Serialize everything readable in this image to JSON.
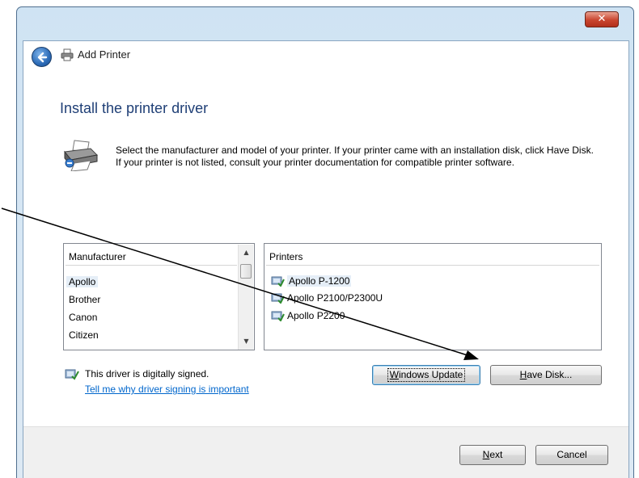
{
  "window": {
    "title": "Add Printer",
    "close_label": "✕"
  },
  "page": {
    "heading": "Install the printer driver",
    "description": "Select the manufacturer and model of your printer. If your printer came with an installation disk, click Have Disk. If your printer is not listed, consult your printer documentation for compatible printer software."
  },
  "manufacturer_list": {
    "header": "Manufacturer",
    "items": [
      "Apollo",
      "Brother",
      "Canon",
      "Citizen"
    ],
    "selected": "Apollo"
  },
  "printers_list": {
    "header": "Printers",
    "items": [
      "Apollo P-1200",
      "Apollo P2100/P2300U",
      "Apollo P2200"
    ],
    "selected": "Apollo P-1200"
  },
  "signing": {
    "status": "This driver is digitally signed.",
    "link": "Tell me why driver signing is important"
  },
  "buttons": {
    "windows_update": {
      "accel": "W",
      "rest": "indows Update"
    },
    "have_disk": {
      "accel": "H",
      "rest": "ave Disk..."
    },
    "next": {
      "accel": "N",
      "rest": "ext"
    },
    "cancel": "Cancel"
  },
  "icons": {
    "back": "back-arrow-icon",
    "printer_small": "printer-icon",
    "printer_large": "printer-setup-icon",
    "driver": "driver-icon",
    "close": "close-icon"
  },
  "colors": {
    "heading": "#1f3f76",
    "link": "#0066cc",
    "close_button": "#c9452f",
    "annotation_arrow": "#000000"
  }
}
